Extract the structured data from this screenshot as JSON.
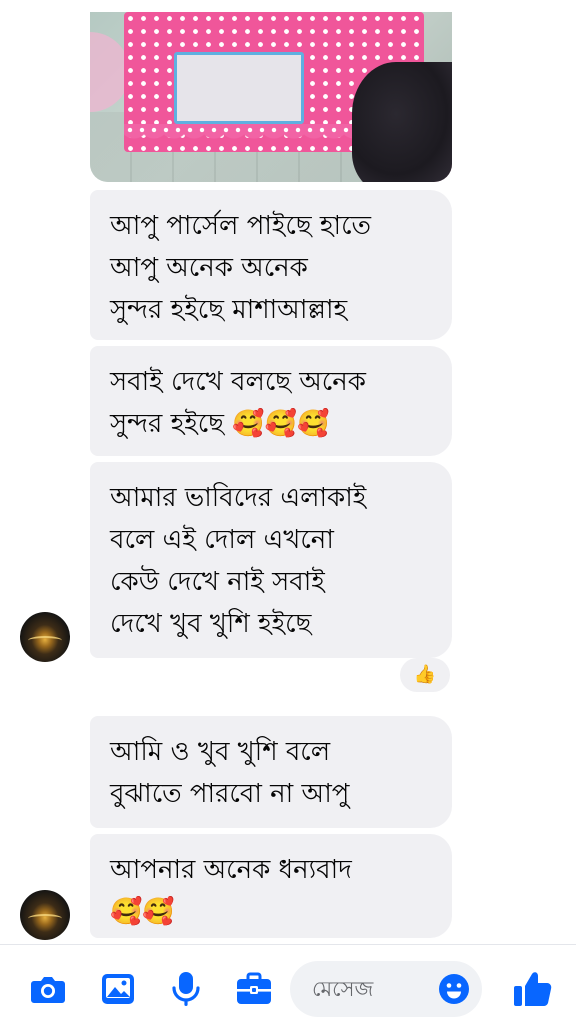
{
  "messages": [
    {
      "text": "আপু পার্সেল পাইছে হাতে\nআপু  অনেক অনেক\nসুন্দর হইছে মাশাআল্লাহ"
    },
    {
      "text": "সবাই দেখে বলছে অনেক\nসুন্দর হইছে 🥰🥰🥰"
    },
    {
      "text": "আমার ভাবিদের এলাকাই\nবলে এই দোল এখনো\nকেউ দেখে নাই সবাই\nদেখে খুব খুশি হইছে"
    },
    {
      "text": "আমি ও খুব খুশি বলে\nবুঝাতে পারবো না আপু"
    },
    {
      "text": "আপনার অনেক ধন্যবাদ\n🥰🥰"
    }
  ],
  "reaction": {
    "emoji": "👍"
  },
  "composer": {
    "placeholder": "মেসেজ",
    "tools": [
      "camera-icon",
      "gallery-icon",
      "microphone-icon",
      "briefcase-icon"
    ],
    "emoji_icon": "smiley-icon",
    "like_icon": "thumbs-up-icon"
  },
  "colors": {
    "accent": "#0866ff",
    "bubble": "#f0f0f3",
    "text": "#050505"
  }
}
